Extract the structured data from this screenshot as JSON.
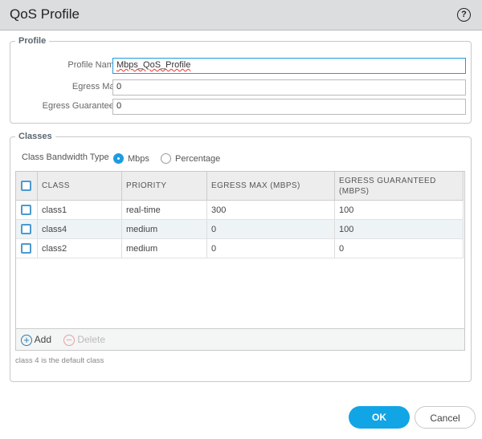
{
  "dialog": {
    "title": "QoS Profile",
    "help": "?"
  },
  "profile": {
    "legend": "Profile",
    "name_label": "Profile Name",
    "name_value": "Mbps_QoS_Profile",
    "egress_max_label": "Egress Max",
    "egress_max_value": "0",
    "egress_guaranteed_label": "Egress Guaranteed",
    "egress_guaranteed_value": "0"
  },
  "classes": {
    "legend": "Classes",
    "bandwidth_type_label": "Class Bandwidth Type",
    "options": [
      "Mbps",
      "Percentage"
    ],
    "selected": "Mbps",
    "columns": [
      "CLASS",
      "PRIORITY",
      "EGRESS MAX (MBPS)",
      "EGRESS GUARANTEED (MBPS)"
    ],
    "rows": [
      [
        "class1",
        "real-time",
        "300",
        "100"
      ],
      [
        "class4",
        "medium",
        "0",
        "100"
      ],
      [
        "class2",
        "medium",
        "0",
        "0"
      ]
    ],
    "add_label": "Add",
    "delete_label": "Delete",
    "note": "class 4 is the default class"
  },
  "buttons": {
    "ok": "OK",
    "cancel": "Cancel"
  },
  "colors": {
    "accent": "#1f9bde",
    "header": "#dcdddf"
  }
}
